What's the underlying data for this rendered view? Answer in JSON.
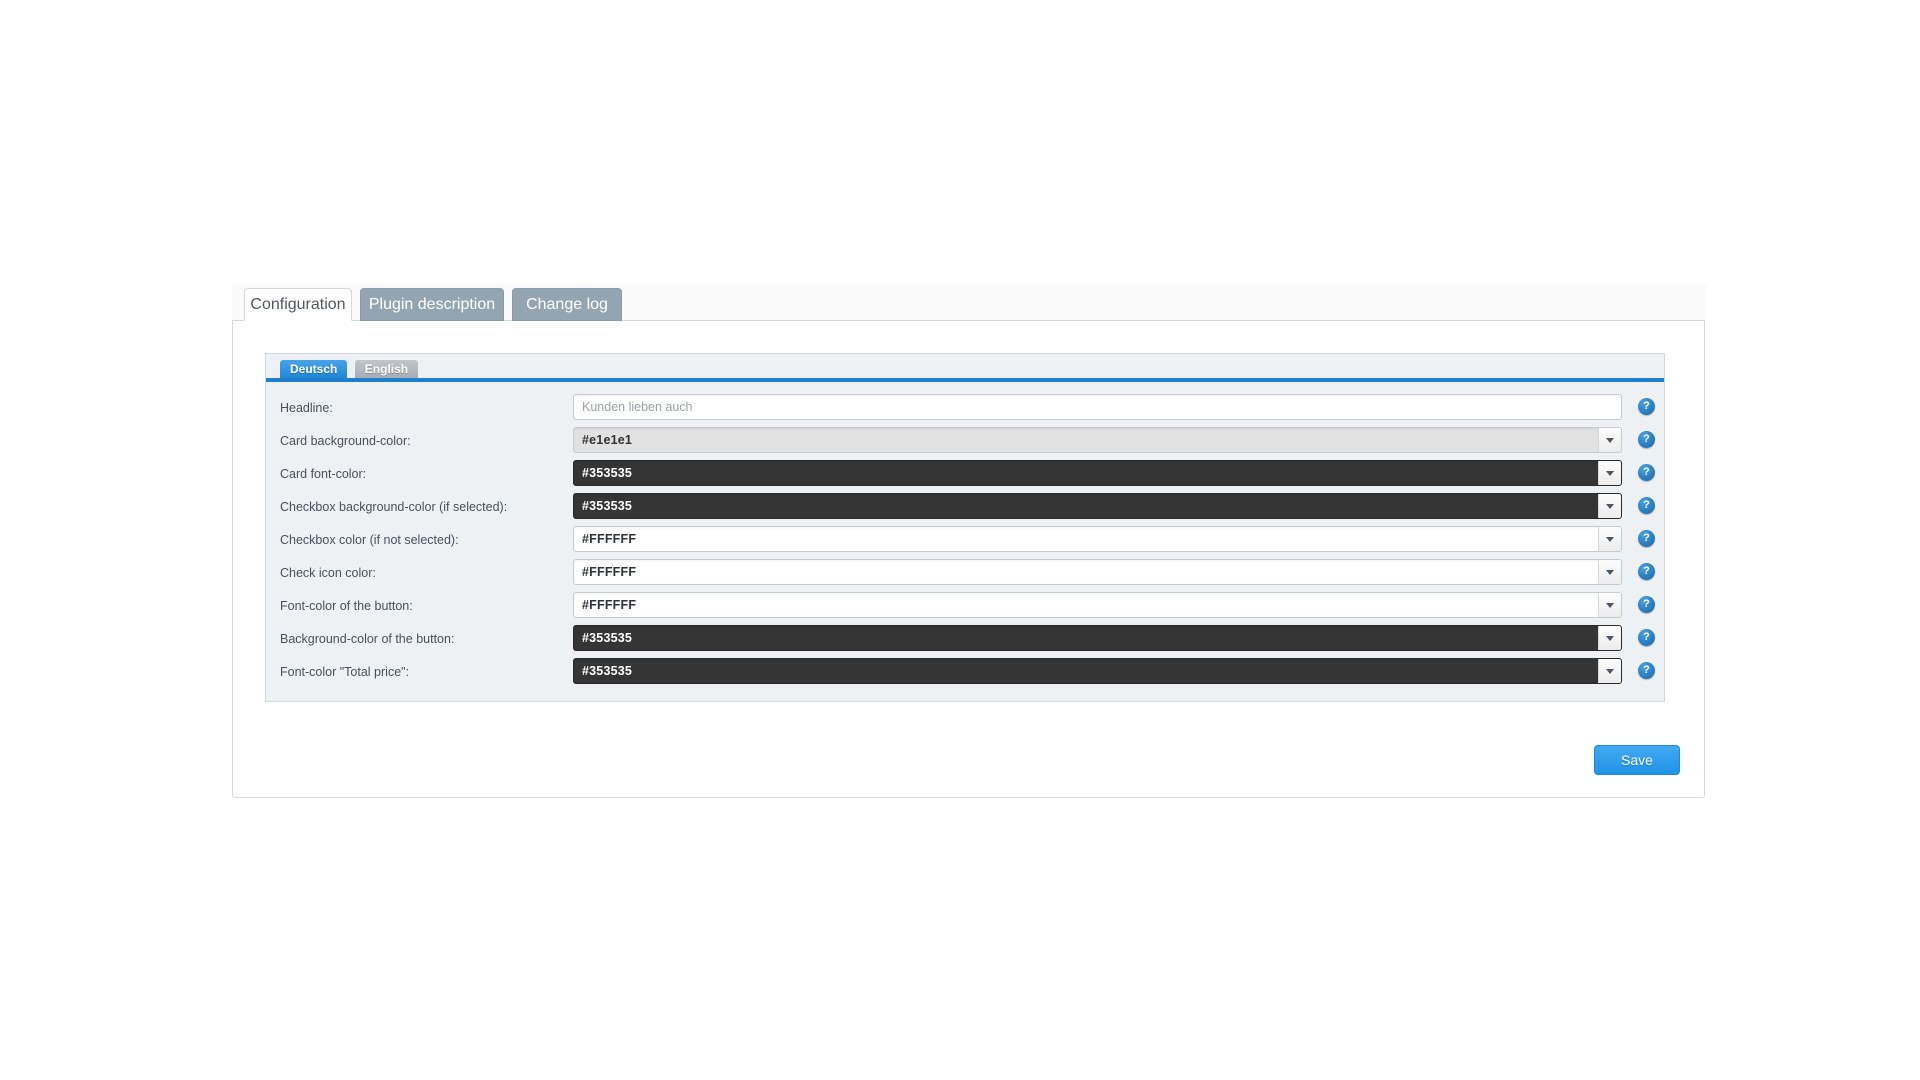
{
  "tabs": [
    {
      "label": "Configuration",
      "active": true
    },
    {
      "label": "Plugin description",
      "active": false
    },
    {
      "label": "Change log",
      "active": false
    }
  ],
  "language_tabs": [
    {
      "label": "Deutsch",
      "active": true
    },
    {
      "label": "English",
      "active": false
    }
  ],
  "form": {
    "rows": [
      {
        "label": "Headline:",
        "control": "text",
        "value": "",
        "placeholder": "Kunden lieben auch",
        "help": "?"
      },
      {
        "label": "Card background-color:",
        "control": "select",
        "value": "#e1e1e1",
        "variant": "grey",
        "help": "?"
      },
      {
        "label": "Card font-color:",
        "control": "select",
        "value": "#353535",
        "variant": "dark",
        "help": "?"
      },
      {
        "label": "Checkbox background-color (if selected):",
        "control": "select",
        "value": "#353535",
        "variant": "dark",
        "help": "?"
      },
      {
        "label": "Checkbox color (if not selected):",
        "control": "select",
        "value": "#FFFFFF",
        "variant": "white",
        "help": "?"
      },
      {
        "label": "Check icon color:",
        "control": "select",
        "value": "#FFFFFF",
        "variant": "white",
        "help": "?"
      },
      {
        "label": "Font-color of the button:",
        "control": "select",
        "value": "#FFFFFF",
        "variant": "white",
        "help": "?"
      },
      {
        "label": "Background-color of the button:",
        "control": "select",
        "value": "#353535",
        "variant": "dark",
        "help": "?"
      },
      {
        "label": "Font-color \"Total price\":",
        "control": "select",
        "value": "#353535",
        "variant": "dark",
        "help": "?"
      }
    ]
  },
  "actions": {
    "save_label": "Save"
  },
  "colors": {
    "accent_blue": "#1f94e6",
    "lang_underline": "#1c7fd0",
    "tab_inactive": "#93a5b1",
    "dark_field": "#353535",
    "grey_field": "#e1e1e1",
    "white_field": "#FFFFFF",
    "help_icon": "#2b7fc0"
  }
}
